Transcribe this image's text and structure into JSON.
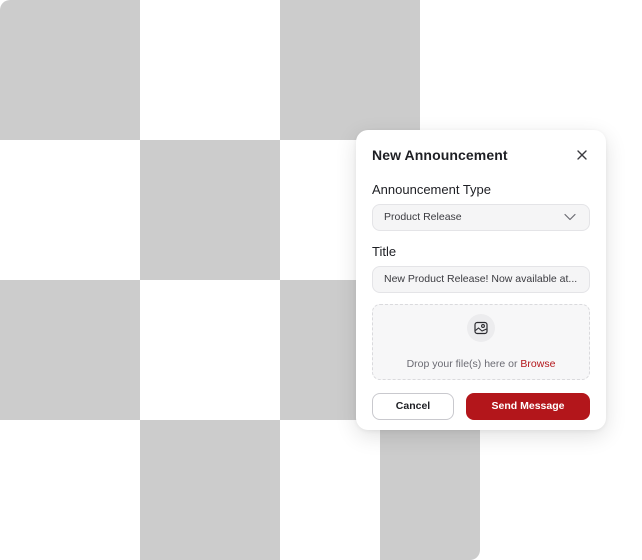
{
  "modal": {
    "title": "New Announcement",
    "close_icon": "close-icon",
    "type_field": {
      "label": "Announcement Type",
      "selected": "Product Release",
      "icon": "chevron-down-icon"
    },
    "title_field": {
      "label": "Title",
      "value": "New Product Release! Now available at..."
    },
    "dropzone": {
      "icon": "image-upload-icon",
      "text": "Drop your file(s) here or",
      "browse_label": "Browse"
    },
    "actions": {
      "cancel_label": "Cancel",
      "send_label": "Send Message"
    }
  },
  "colors": {
    "accent": "#b3161b",
    "checker_tile": "#cccccc"
  }
}
